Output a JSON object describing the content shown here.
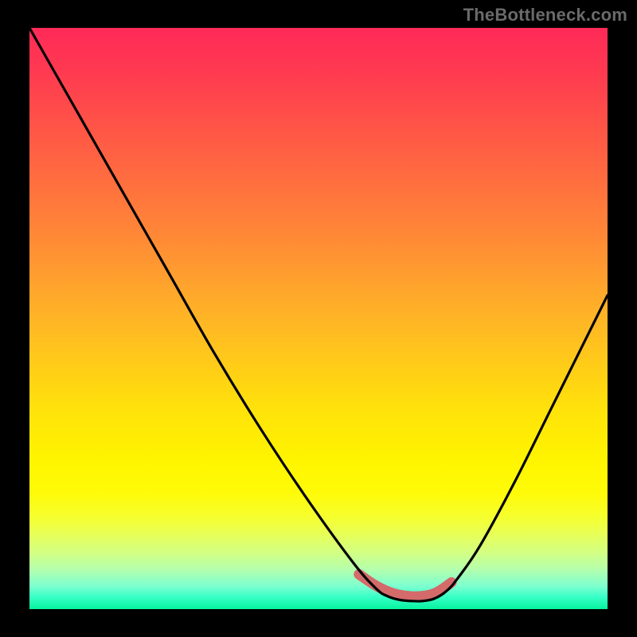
{
  "watermark": "TheBottleneck.com",
  "chart_data": {
    "type": "line",
    "title": "",
    "xlabel": "",
    "ylabel": "",
    "xlim": [
      0,
      100
    ],
    "ylim": [
      0,
      100
    ],
    "series": [
      {
        "name": "bottleneck-curve",
        "x": [
          0,
          8,
          16,
          24,
          32,
          40,
          48,
          56,
          60,
          62,
          64,
          66,
          68,
          70,
          72,
          74,
          78,
          84,
          90,
          96,
          100
        ],
        "values": [
          100,
          86,
          72,
          58,
          44,
          31,
          19,
          8,
          3.5,
          2.2,
          1.6,
          1.4,
          1.4,
          1.8,
          3.0,
          5.2,
          11,
          22,
          34,
          46,
          54
        ]
      },
      {
        "name": "highlight-band",
        "x": [
          57,
          60,
          63,
          66,
          69,
          71,
          73
        ],
        "values": [
          6.0,
          4.0,
          2.7,
          2.2,
          2.4,
          3.2,
          4.6
        ]
      }
    ],
    "colors": {
      "curve": "#000000",
      "highlight": "#d46a6a"
    }
  }
}
